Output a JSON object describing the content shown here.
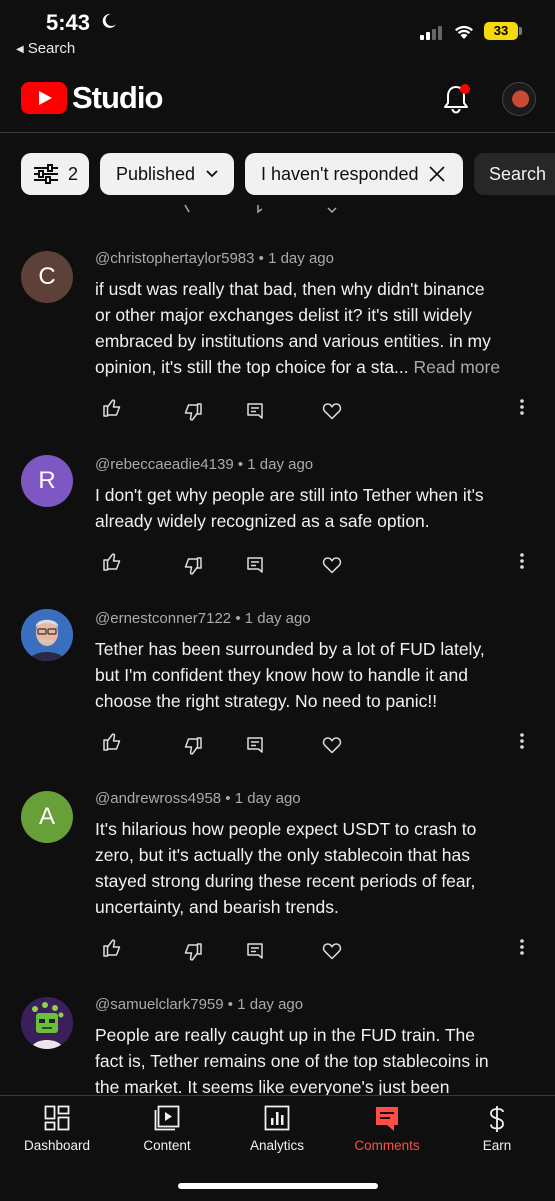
{
  "status": {
    "time": "5:43",
    "back_label": "Search",
    "battery": "33"
  },
  "header": {
    "app_name": "Studio"
  },
  "filters": {
    "filter_count": "2",
    "published": "Published",
    "response": "I haven't responded",
    "search": "Search"
  },
  "comments": [
    {
      "initial": "C",
      "avatar_color": "#5d4037",
      "user": "@christophertaylor5983",
      "time": "1 day ago",
      "lines": [
        "if usdt was really that bad, then why didn't binance",
        "or other major exchanges delist it? it's still widely",
        "embraced by institutions and various entities. in my",
        "opinion, it's still the top choice for a sta..."
      ],
      "read_more": "Read more"
    },
    {
      "initial": "R",
      "avatar_color": "#7e57c2",
      "user": "@rebeccaeadie4139",
      "time": "1 day ago",
      "lines": [
        "I don't get why people are still into Tether when it's",
        "already widely recognized as a safe option."
      ]
    },
    {
      "initial": "",
      "avatar_color": "#3a6fbf",
      "user": "@ernestconner7122",
      "time": "1 day ago",
      "lines": [
        "Tether has been surrounded by a lot of FUD lately,",
        "but I'm confident they know how to handle it and",
        "choose the right strategy. No need to panic!!"
      ]
    },
    {
      "initial": "A",
      "avatar_color": "#689f38",
      "user": "@andrewross4958",
      "time": "1 day ago",
      "lines": [
        "It's hilarious how people expect USDT to crash to",
        "zero, but it's actually the only stablecoin that has",
        "stayed strong during these recent periods of fear,",
        "uncertainty, and bearish trends."
      ]
    },
    {
      "initial": "",
      "avatar_color": "#3b1f5a",
      "user": "@samuelclark7959",
      "time": "1 day ago",
      "lines": [
        "People are really caught up in the FUD train. The",
        "fact is, Tether remains one of the top stablecoins in",
        "the market. It seems like everyone's just been"
      ]
    }
  ],
  "nav": {
    "dashboard": "Dashboard",
    "content": "Content",
    "analytics": "Analytics",
    "comments": "Comments",
    "earn": "Earn"
  },
  "colors": {
    "accent": "#ff4e45",
    "brand_red": "#ff0000",
    "background": "#0f0f0f"
  }
}
